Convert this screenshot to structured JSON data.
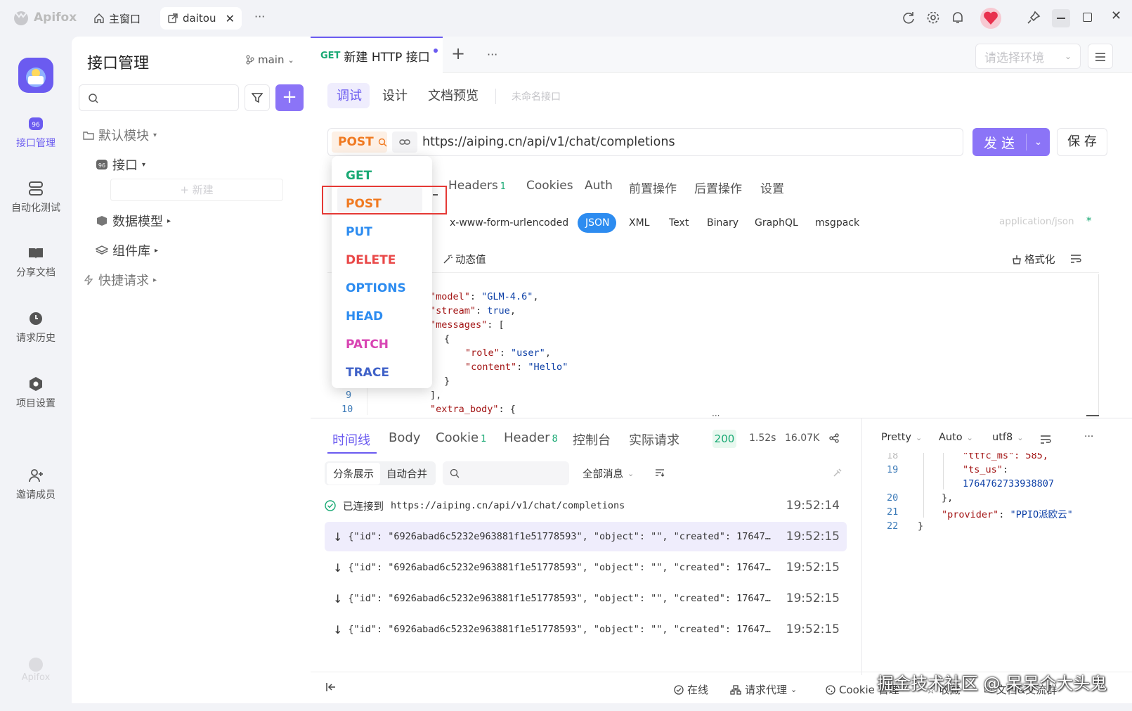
{
  "app": {
    "name": "Apifox",
    "footer_logo": "Apifox"
  },
  "titlebar": {
    "tabs": [
      {
        "label": "主窗口",
        "icon": "home-icon"
      },
      {
        "label": "daitou",
        "icon": "external-link-icon"
      }
    ],
    "more": "···"
  },
  "leftnav": {
    "items": [
      {
        "label": "接口管理",
        "icon": "api-icon"
      },
      {
        "label": "自动化测试",
        "icon": "automation-icon"
      },
      {
        "label": "分享文档",
        "icon": "book-icon"
      },
      {
        "label": "请求历史",
        "icon": "clock-icon"
      },
      {
        "label": "项目设置",
        "icon": "settings-icon"
      },
      {
        "label": "邀请成员",
        "icon": "add-user-icon"
      }
    ]
  },
  "sidebar": {
    "title": "接口管理",
    "branch": "main",
    "tree": {
      "default_module": "默认模块",
      "api_folder": "接口",
      "new_placeholder": "+ 新建",
      "data_models": "数据模型",
      "components": "组件库",
      "quick_request": "快捷请求"
    }
  },
  "main": {
    "doc_tab": {
      "method": "GET",
      "title": "新建 HTTP 接口"
    },
    "env_placeholder": "请选择环境",
    "subtabs": [
      "调试",
      "设计",
      "文档预览"
    ],
    "unnamed": "未命名接口",
    "method": "POST",
    "url": "https://aiping.cn/api/v1/chat/completions",
    "send": "发 送",
    "save": "保 存",
    "param_tabs": [
      {
        "label": "Headers",
        "count": "1"
      },
      {
        "label": "Cookies"
      },
      {
        "label": "Auth"
      },
      {
        "label": "前置操作"
      },
      {
        "label": "后置操作"
      },
      {
        "label": "设置"
      }
    ],
    "body_types": [
      "x-www-form-urlencoded",
      "JSON",
      "XML",
      "Text",
      "Binary",
      "GraphQL",
      "msgpack"
    ],
    "content_type": "application/json",
    "required_mark": "*",
    "dynamic_value": "动态值",
    "format": "格式化",
    "line_numbers": [
      "9",
      "10"
    ]
  },
  "method_menu": {
    "items": [
      {
        "label": "GET",
        "color": "#19a974"
      },
      {
        "label": "POST",
        "color": "#f07a21"
      },
      {
        "label": "PUT",
        "color": "#2d8cf0"
      },
      {
        "label": "DELETE",
        "color": "#e94848"
      },
      {
        "label": "OPTIONS",
        "color": "#2d8cf0"
      },
      {
        "label": "HEAD",
        "color": "#2d8cf0"
      },
      {
        "label": "PATCH",
        "color": "#d845b3"
      },
      {
        "label": "TRACE",
        "color": "#4062c8"
      }
    ]
  },
  "response": {
    "tabs": [
      {
        "label": "时间线"
      },
      {
        "label": "Body"
      },
      {
        "label": "Cookie",
        "count": "1"
      },
      {
        "label": "Header",
        "count": "8"
      },
      {
        "label": "控制台"
      },
      {
        "label": "实际请求"
      }
    ],
    "status": "200",
    "time": "1.52s",
    "size": "16.07K",
    "view_modes": [
      "分条展示",
      "自动合并"
    ],
    "filter": "全部消息",
    "format_options": [
      "Pretty",
      "Auto",
      "utf8"
    ],
    "timeline": [
      {
        "text": "已连接到",
        "url": "https://aiping.cn/api/v1/chat/completions",
        "time": "19:52:14"
      },
      {
        "text": "{\"id\": \"6926abad6c5232e963881f1e51778593\", \"object\": \"\", \"created\": 17647…",
        "time": "19:52:15"
      },
      {
        "text": "{\"id\": \"6926abad6c5232e963881f1e51778593\", \"object\": \"\", \"created\": 17647…",
        "time": "19:52:15"
      },
      {
        "text": "{\"id\": \"6926abad6c5232e963881f1e51778593\", \"object\": \"\", \"created\": 17647…",
        "time": "19:52:15"
      },
      {
        "text": "{\"id\": \"6926abad6c5232e963881f1e51778593\", \"object\": \"\", \"created\": 17647…",
        "time": "19:52:15"
      }
    ],
    "json_lines": [
      "19",
      "20",
      "21",
      "22"
    ]
  },
  "statusbar": {
    "online": "在线",
    "proxy": "请求代理",
    "cookie": "Cookie 管理",
    "favorites": "收藏",
    "docs": "文档&交流群"
  },
  "watermark": "掘金技术社区 @ 呆呆个大头鬼"
}
